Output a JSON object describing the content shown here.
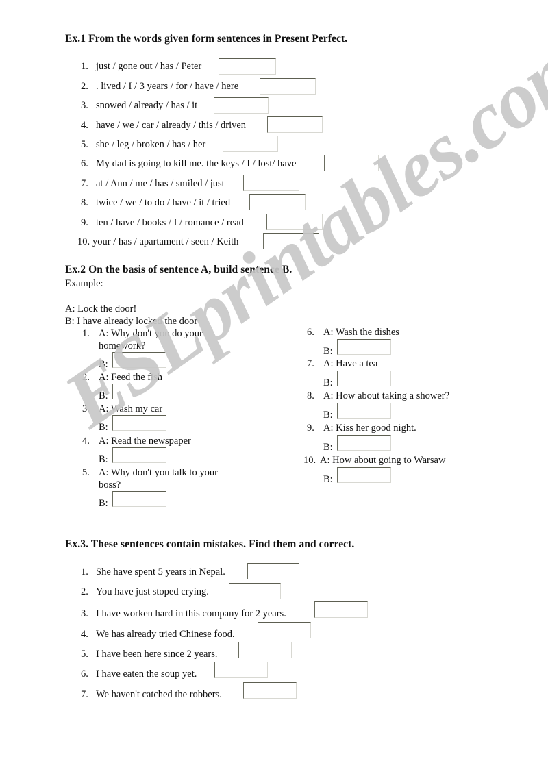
{
  "document": {
    "type": "worksheet",
    "topic": "Present Perfect",
    "watermark": "ESLprintables.com",
    "watermark_color": "#c8c8c8",
    "page_background": "#ffffff",
    "text_color": "#111111",
    "box_border_color": "#5d5f51"
  },
  "ex1": {
    "heading": "Ex.1 From the words given form sentences in Present Perfect.",
    "items": [
      {
        "num": "1.",
        "text": "just / gone out / has / Peter"
      },
      {
        "num": "2.",
        "text": ". lived / I / 3 years / for / have / here"
      },
      {
        "num": "3.",
        "text": "snowed / already / has / it"
      },
      {
        "num": "4.",
        "text": "have / we / car / already / this / driven"
      },
      {
        "num": "5.",
        "text": "she / leg / broken / has / her"
      },
      {
        "num": "6.",
        "text": "My dad is going to kill me. the keys / I / lost/ have"
      },
      {
        "num": "7.",
        "text": "at / Ann / me / has / smiled / just"
      },
      {
        "num": "8.",
        "text": "twice / we / to do / have / it / tried"
      },
      {
        "num": "9.",
        "text": "ten / have / books / I / romance / read"
      },
      {
        "num": "10.",
        "text": "your / has / apartament / seen / Keith"
      }
    ]
  },
  "ex2": {
    "heading": "Ex.2 On the basis of sentence A, build sentence B.",
    "example_label": "Example:",
    "example_a": "A: Lock the door!",
    "example_b": "B: I have already locked the door",
    "answer_prefix": "B:",
    "left_items": [
      {
        "num": "1.",
        "prompt": "A: Why don't you do your",
        "prompt2": "homework?"
      },
      {
        "num": "2.",
        "prompt": "A: Feed the fish",
        "prompt2": ""
      },
      {
        "num": "3.",
        "prompt": "A: Wash my car",
        "prompt2": ""
      },
      {
        "num": "4.",
        "prompt": "A: Read the newspaper",
        "prompt2": ""
      },
      {
        "num": "5.",
        "prompt": "A: Why don't you talk to your",
        "prompt2": "boss?"
      }
    ],
    "right_items": [
      {
        "num": "6.",
        "prompt": "A: Wash the dishes",
        "prompt2": ""
      },
      {
        "num": "7.",
        "prompt": "A: Have a tea",
        "prompt2": ""
      },
      {
        "num": "8.",
        "prompt": "A: How about taking a shower?",
        "prompt2": ""
      },
      {
        "num": "9.",
        "prompt": "A: Kiss her good night.",
        "prompt2": ""
      },
      {
        "num": "10.",
        "prompt": "A: How about going to Warsaw",
        "prompt2": ""
      }
    ]
  },
  "ex3": {
    "heading": "Ex.3. These sentences contain mistakes. Find them and correct.",
    "items": [
      {
        "num": "1.",
        "text": "She have spent 5 years in Nepal."
      },
      {
        "num": "2.",
        "text": "You have just stoped crying."
      },
      {
        "num": "3.",
        "text": "I have worken hard in this company for 2 years."
      },
      {
        "num": "4.",
        "text": "We has already tried Chinese food."
      },
      {
        "num": "5.",
        "text": "I have been here since 2 years."
      },
      {
        "num": "6.",
        "text": "I have eaten the soup yet."
      },
      {
        "num": "7.",
        "text": "We haven't catched the robbers."
      }
    ]
  }
}
